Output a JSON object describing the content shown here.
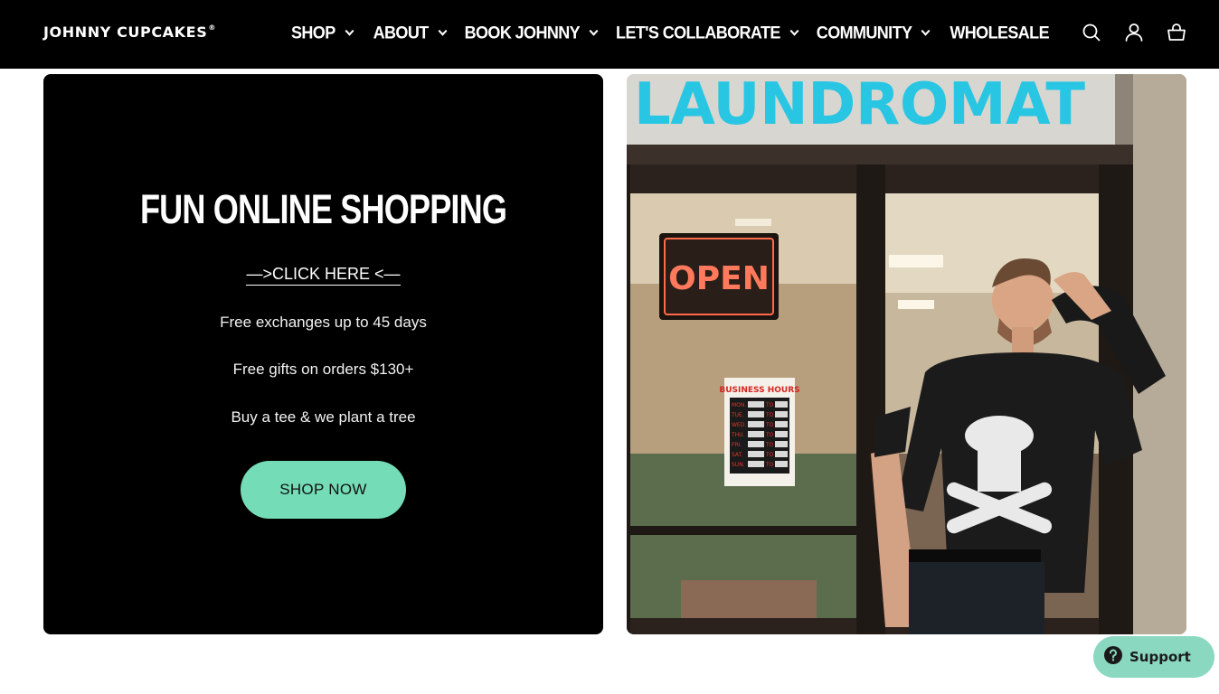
{
  "header": {
    "logo_text": "JOHNNY CUPCAKES",
    "logo_mark": "®",
    "nav": [
      {
        "label": "SHOP",
        "has_dropdown": true
      },
      {
        "label": "ABOUT",
        "has_dropdown": true
      },
      {
        "label": "BOOK JOHNNY",
        "has_dropdown": true
      },
      {
        "label": "LET'S COLLABORATE",
        "has_dropdown": true
      },
      {
        "label": "COMMUNITY",
        "has_dropdown": true
      },
      {
        "label": "WHOLESALE",
        "has_dropdown": false
      }
    ],
    "icons": [
      "search-icon",
      "account-icon",
      "cart-icon"
    ]
  },
  "promo": {
    "title": "FUN ONLINE SHOPPING",
    "click_here": "—>CLICK HERE <—",
    "perks": [
      "Free exchanges up to 45 days",
      "Free gifts on orders $130+",
      "Buy a tee & we plant a tree"
    ],
    "cta": "SHOP NOW"
  },
  "photo": {
    "sign_text": "LAUNDROMAT",
    "open_sign": "OPEN",
    "hours_sign": "BUSINESS HOURS",
    "hours_days": [
      "MON.",
      "TUE.",
      "WED.",
      "THU.",
      "FRI.",
      "SAT.",
      "SUN."
    ],
    "hours_to": "TO"
  },
  "support": {
    "label": "Support"
  },
  "colors": {
    "header_bg": "#000000",
    "accent": "#74dcb7",
    "support_bg": "#8ad8bf"
  }
}
